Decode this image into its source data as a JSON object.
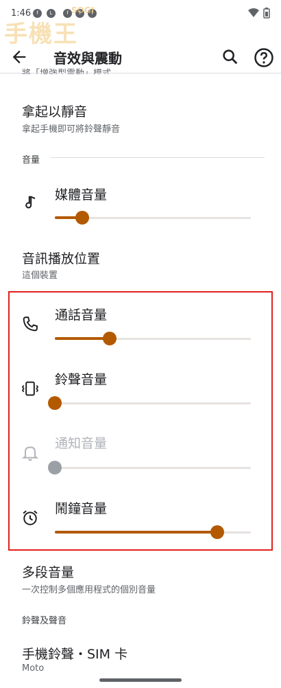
{
  "status_bar": {
    "time": "1:46",
    "notification_icons": [
      "facebook-icon",
      "line-icon",
      "facebook-icon",
      "facebook-icon",
      "facebook-icon"
    ]
  },
  "watermark": {
    "text": "手機王",
    "small": "SOGI"
  },
  "header": {
    "title": "音效與震動",
    "back_icon": "arrow-back-icon",
    "search_icon": "search-icon",
    "help_icon": "help-icon"
  },
  "cutoff_text": "將「增強型震動」模式",
  "items": {
    "pickup_mute": {
      "title": "拿起以靜音",
      "subtitle": "拿起手機即可將鈴聲靜音"
    },
    "audio_output": {
      "title": "音訊播放位置",
      "subtitle": "這個裝置"
    },
    "multi_volume": {
      "title": "多段音量",
      "subtitle": "一次控制多個應用程式的個別音量"
    },
    "ringtone": {
      "title": "手機鈴聲・SIM 卡",
      "subtitle": "Moto"
    }
  },
  "sections": {
    "volume": "音量",
    "ringtones": "鈴聲及聲音"
  },
  "volumes": [
    {
      "key": "media",
      "label": "媒體音量",
      "icon": "music-note-icon",
      "level": 0.14,
      "enabled": true
    },
    {
      "key": "call",
      "label": "通話音量",
      "icon": "phone-icon",
      "level": 0.28,
      "enabled": true
    },
    {
      "key": "ring",
      "label": "鈴聲音量",
      "icon": "vibrate-icon",
      "level": 0.0,
      "enabled": true
    },
    {
      "key": "notification",
      "label": "通知音量",
      "icon": "bell-icon",
      "level": 0.0,
      "enabled": false
    },
    {
      "key": "alarm",
      "label": "鬧鐘音量",
      "icon": "alarm-clock-icon",
      "level": 0.83,
      "enabled": true
    }
  ],
  "colors": {
    "accent": "#b35900",
    "highlight_border": "#e0201b",
    "disabled": "#9aa0a6"
  }
}
